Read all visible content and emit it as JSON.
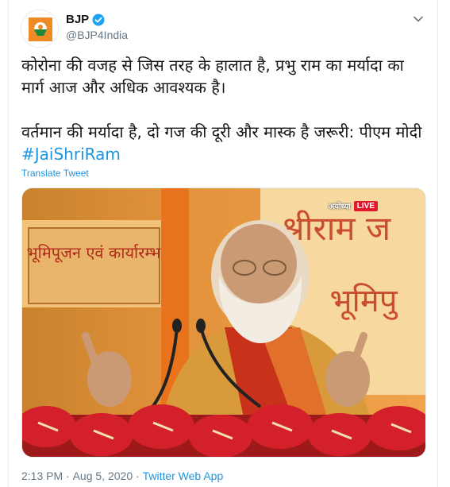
{
  "tweet": {
    "display_name": "BJP",
    "handle": "@BJP4India",
    "text_line1": "कोरोना की वजह से जिस तरह के हालात है, प्रभु राम का मर्यादा का मार्ग आज और अधिक आवश्यक है।",
    "text_line2": "वर्तमान की मर्यादा है, दो गज की दूरी और मास्क है जरूरी: पीएम मोदी ",
    "hashtag": "#JaiShriRam",
    "translate_label": "Translate Tweet",
    "media": {
      "live_place": "अयोध्या",
      "live_label": "LIVE",
      "banner_left": "भूमिपूजन एवं कार्यारम्भ",
      "banner_right_top": "श्रीराम ज",
      "banner_right_bottom": "भूमिपु"
    },
    "time": "2:13 PM",
    "separator1": " · ",
    "date": "Aug 5, 2020",
    "separator2": " · ",
    "source": "Twitter Web App"
  },
  "icons": {
    "verified": "verified-badge-icon",
    "more": "chevron-down-icon"
  },
  "colors": {
    "link": "#1b95e0",
    "verified": "#1da1f2",
    "muted": "#657786",
    "live": "#e0182d",
    "saffron": "#f08a24"
  }
}
